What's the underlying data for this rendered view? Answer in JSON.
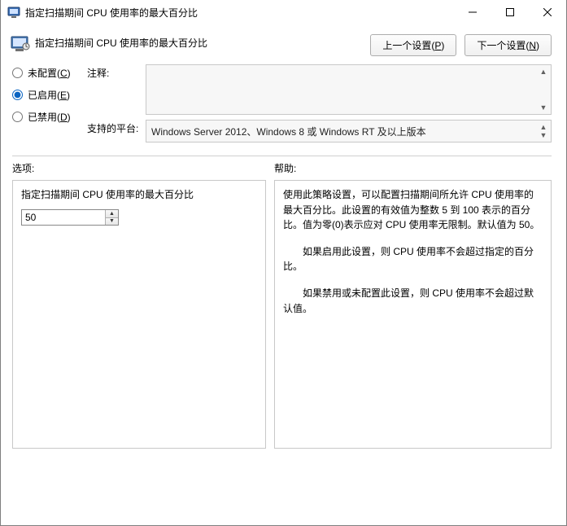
{
  "window": {
    "title": "指定扫描期间 CPU 使用率的最大百分比"
  },
  "header": {
    "title": "指定扫描期间 CPU 使用率的最大百分比",
    "prev_button": "上一个设置(",
    "prev_key": "P",
    "next_button": "下一个设置(",
    "next_key": "N",
    "btn_close": ")"
  },
  "radios": {
    "not_configured": "未配置(",
    "not_configured_key": "C",
    "enabled": "已启用(",
    "enabled_key": "E",
    "disabled": "已禁用(",
    "disabled_key": "D",
    "close": ")"
  },
  "fields": {
    "comment_label": "注释:",
    "comment_value": "",
    "platforms_label": "支持的平台:",
    "platforms_value": "Windows Server 2012、Windows 8 或 Windows RT 及以上版本"
  },
  "panels": {
    "options_label": "选项:",
    "help_label": "帮助:"
  },
  "options": {
    "label": "指定扫描期间 CPU 使用率的最大百分比",
    "value": "50"
  },
  "help": {
    "p1": "使用此策略设置，可以配置扫描期间所允许 CPU 使用率的最大百分比。此设置的有效值为整数 5 到 100 表示的百分比。值为零(0)表示应对 CPU 使用率无限制。默认值为 50。",
    "p2": "如果启用此设置，则 CPU 使用率不会超过指定的百分比。",
    "p3": "如果禁用或未配置此设置，则 CPU 使用率不会超过默认值。"
  }
}
